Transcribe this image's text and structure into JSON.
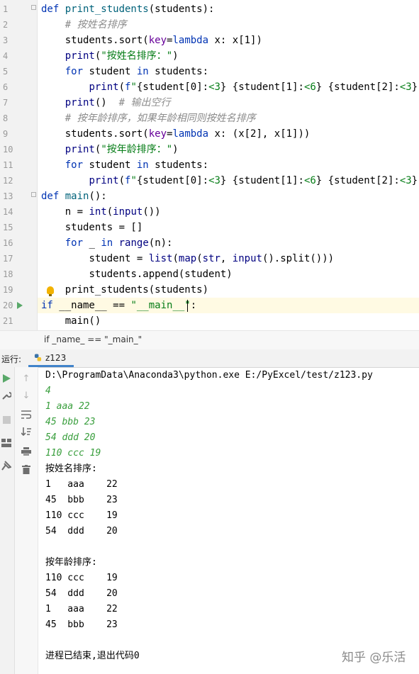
{
  "editor": {
    "line_numbers": [
      "1",
      "2",
      "3",
      "4",
      "5",
      "6",
      "7",
      "8",
      "9",
      "10",
      "11",
      "12",
      "13",
      "14",
      "15",
      "16",
      "17",
      "18",
      "19",
      "20",
      "21"
    ],
    "lines": [
      {
        "indent": "",
        "tokens": [
          [
            "kw",
            "def "
          ],
          [
            "fn",
            "print_students"
          ],
          [
            "",
            "(students):"
          ]
        ]
      },
      {
        "indent": "    ",
        "tokens": [
          [
            "cm",
            "# 按姓名排序"
          ]
        ]
      },
      {
        "indent": "    ",
        "tokens": [
          [
            "",
            "students.sort("
          ],
          [
            "kwarg",
            "key"
          ],
          [
            "",
            "="
          ],
          [
            "kw",
            "lambda"
          ],
          [
            "",
            " x: x[1])"
          ]
        ]
      },
      {
        "indent": "    ",
        "tokens": [
          [
            "bi",
            "print"
          ],
          [
            "",
            "("
          ],
          [
            "str",
            "\"按姓名排序：\""
          ],
          [
            "",
            ")"
          ]
        ]
      },
      {
        "indent": "    ",
        "tokens": [
          [
            "kw",
            "for"
          ],
          [
            "",
            " student "
          ],
          [
            "kw",
            "in"
          ],
          [
            "",
            " students:"
          ]
        ]
      },
      {
        "indent": "        ",
        "tokens": [
          [
            "bi",
            "print"
          ],
          [
            "",
            "("
          ],
          [
            "kw",
            "f"
          ],
          [
            "str",
            "\""
          ],
          [
            "",
            "{student[0]:"
          ],
          [
            "str",
            "<3"
          ],
          [
            "",
            "} "
          ],
          [
            "",
            "{student[1]:"
          ],
          [
            "str",
            "<6"
          ],
          [
            "",
            "} "
          ],
          [
            "",
            "{student[2]:"
          ],
          [
            "str",
            "<3"
          ],
          [
            "",
            "}"
          ],
          [
            "str",
            "\""
          ],
          [
            "",
            ")"
          ]
        ]
      },
      {
        "indent": "    ",
        "tokens": [
          [
            "bi",
            "print"
          ],
          [
            "",
            "()  "
          ],
          [
            "cm",
            "# 输出空行"
          ]
        ]
      },
      {
        "indent": "    ",
        "tokens": [
          [
            "cm",
            "# 按年龄排序，如果年龄相同则按姓名排序"
          ]
        ]
      },
      {
        "indent": "    ",
        "tokens": [
          [
            "",
            "students.sort("
          ],
          [
            "kwarg",
            "key"
          ],
          [
            "",
            "="
          ],
          [
            "kw",
            "lambda"
          ],
          [
            "",
            " x: (x[2], x[1]))"
          ]
        ]
      },
      {
        "indent": "    ",
        "tokens": [
          [
            "bi",
            "print"
          ],
          [
            "",
            "("
          ],
          [
            "str",
            "\"按年龄排序：\""
          ],
          [
            "",
            ")"
          ]
        ]
      },
      {
        "indent": "    ",
        "tokens": [
          [
            "kw",
            "for"
          ],
          [
            "",
            " student "
          ],
          [
            "kw",
            "in"
          ],
          [
            "",
            " students:"
          ]
        ]
      },
      {
        "indent": "        ",
        "tokens": [
          [
            "bi",
            "print"
          ],
          [
            "",
            "("
          ],
          [
            "kw",
            "f"
          ],
          [
            "str",
            "\""
          ],
          [
            "",
            "{student[0]:"
          ],
          [
            "str",
            "<3"
          ],
          [
            "",
            "} "
          ],
          [
            "",
            "{student[1]:"
          ],
          [
            "str",
            "<6"
          ],
          [
            "",
            "} "
          ],
          [
            "",
            "{student[2]:"
          ],
          [
            "str",
            "<3"
          ],
          [
            "",
            "}"
          ],
          [
            "str",
            "\""
          ],
          [
            "",
            ")"
          ]
        ]
      },
      {
        "indent": "",
        "tokens": [
          [
            "kw",
            "def "
          ],
          [
            "fn",
            "main"
          ],
          [
            "",
            "():"
          ]
        ]
      },
      {
        "indent": "    ",
        "tokens": [
          [
            "",
            "n = "
          ],
          [
            "bi",
            "int"
          ],
          [
            "",
            "("
          ],
          [
            "bi",
            "input"
          ],
          [
            "",
            "())"
          ]
        ]
      },
      {
        "indent": "    ",
        "tokens": [
          [
            "",
            "students = []"
          ]
        ]
      },
      {
        "indent": "    ",
        "tokens": [
          [
            "kw",
            "for"
          ],
          [
            "",
            " _ "
          ],
          [
            "kw",
            "in"
          ],
          [
            "",
            " "
          ],
          [
            "bi",
            "range"
          ],
          [
            "",
            "(n):"
          ]
        ]
      },
      {
        "indent": "        ",
        "tokens": [
          [
            "",
            "student = "
          ],
          [
            "bi",
            "list"
          ],
          [
            "",
            "("
          ],
          [
            "bi",
            "map"
          ],
          [
            "",
            "("
          ],
          [
            "bi",
            "str"
          ],
          [
            "",
            ", "
          ],
          [
            "bi",
            "input"
          ],
          [
            "",
            "().split()))"
          ]
        ]
      },
      {
        "indent": "        ",
        "tokens": [
          [
            "",
            "students.append(student)"
          ]
        ]
      },
      {
        "indent": "    ",
        "tokens": [
          [
            "",
            "print_students(students)"
          ]
        ]
      },
      {
        "indent": "",
        "tokens": [
          [
            "kw",
            "if"
          ],
          [
            "",
            " __name__ == "
          ],
          [
            "str",
            "\"__main__\""
          ],
          [
            "",
            ":"
          ]
        ]
      },
      {
        "indent": "    ",
        "tokens": [
          [
            "",
            "main()"
          ]
        ]
      }
    ]
  },
  "breadcrumb": "if _name_ == \"_main_\"",
  "run_panel": {
    "label": "运行:",
    "tab_name": "z123"
  },
  "console": [
    {
      "type": "out",
      "text": "D:\\ProgramData\\Anaconda3\\python.exe E:/PyExcel/test/z123.py"
    },
    {
      "type": "in",
      "text": "4"
    },
    {
      "type": "in",
      "text": "1 aaa 22"
    },
    {
      "type": "in",
      "text": "45 bbb 23"
    },
    {
      "type": "in",
      "text": "54 ddd 20"
    },
    {
      "type": "in",
      "text": "110 ccc 19"
    },
    {
      "type": "out",
      "text": "按姓名排序:"
    },
    {
      "type": "out",
      "text": "1   aaa    22"
    },
    {
      "type": "out",
      "text": "45  bbb    23"
    },
    {
      "type": "out",
      "text": "110 ccc    19"
    },
    {
      "type": "out",
      "text": "54  ddd    20"
    },
    {
      "type": "out",
      "text": ""
    },
    {
      "type": "out",
      "text": "按年龄排序:"
    },
    {
      "type": "out",
      "text": "110 ccc    19"
    },
    {
      "type": "out",
      "text": "54  ddd    20"
    },
    {
      "type": "out",
      "text": "1   aaa    22"
    },
    {
      "type": "out",
      "text": "45  bbb    23"
    },
    {
      "type": "out",
      "text": ""
    },
    {
      "type": "out",
      "text": "进程已结束,退出代码0"
    }
  ],
  "toolbar_icons": {
    "outer": [
      "run-icon",
      "wrench-icon",
      "stop-icon",
      "layout-icon",
      "pin-icon"
    ],
    "inner": [
      "up-arrow-icon",
      "down-arrow-icon",
      "soft-wrap-icon",
      "sort-icon",
      "print-icon",
      "trash-icon"
    ]
  },
  "watermark": "知乎 @乐活"
}
